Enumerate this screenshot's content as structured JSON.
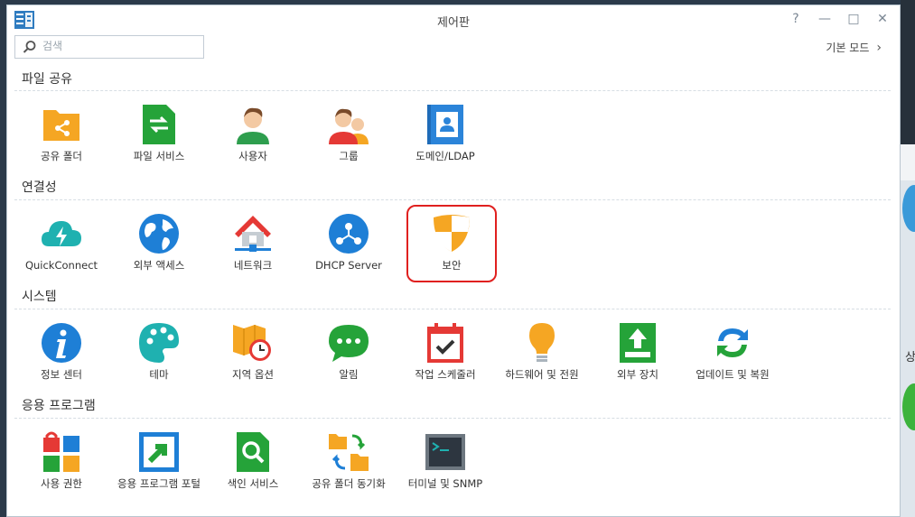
{
  "window": {
    "title": "제어판",
    "controls": {
      "help": "?",
      "minimize": "—",
      "maximize": "□",
      "close": "✕"
    }
  },
  "search": {
    "placeholder": "검색",
    "value": ""
  },
  "basic_mode": {
    "label": "기본 모드",
    "icon": "chevron-right-icon"
  },
  "sections": [
    {
      "title": "파일 공유",
      "items": [
        {
          "label": "공유 폴더",
          "icon": "shared-folder-icon"
        },
        {
          "label": "파일 서비스",
          "icon": "file-services-icon"
        },
        {
          "label": "사용자",
          "icon": "user-icon"
        },
        {
          "label": "그룹",
          "icon": "group-icon"
        },
        {
          "label": "도메인/LDAP",
          "icon": "domain-ldap-icon"
        }
      ]
    },
    {
      "title": "연결성",
      "items": [
        {
          "label": "QuickConnect",
          "icon": "quickconnect-icon"
        },
        {
          "label": "외부 액세스",
          "icon": "external-access-icon"
        },
        {
          "label": "네트워크",
          "icon": "network-icon"
        },
        {
          "label": "DHCP Server",
          "icon": "dhcp-server-icon"
        },
        {
          "label": "보안",
          "icon": "security-shield-icon",
          "highlighted": true
        }
      ]
    },
    {
      "title": "시스템",
      "items": [
        {
          "label": "정보 센터",
          "icon": "info-center-icon"
        },
        {
          "label": "테마",
          "icon": "theme-palette-icon"
        },
        {
          "label": "지역 옵션",
          "icon": "regional-options-icon"
        },
        {
          "label": "알림",
          "icon": "notification-icon"
        },
        {
          "label": "작업 스케줄러",
          "icon": "task-scheduler-icon"
        },
        {
          "label": "하드웨어 및 전원",
          "icon": "hardware-power-icon"
        },
        {
          "label": "외부 장치",
          "icon": "external-devices-icon"
        },
        {
          "label": "업데이트 및 복원",
          "icon": "update-restore-icon"
        }
      ]
    },
    {
      "title": "응용 프로그램",
      "items": [
        {
          "label": "사용 권한",
          "icon": "privileges-icon"
        },
        {
          "label": "응용 프로그램 포털",
          "icon": "application-portal-icon"
        },
        {
          "label": "색인 서비스",
          "icon": "indexing-service-icon"
        },
        {
          "label": "공유 폴더 동기화",
          "icon": "shared-folder-sync-icon"
        },
        {
          "label": "터미널 및 SNMP",
          "icon": "terminal-snmp-icon"
        }
      ]
    }
  ],
  "background_glyph": "상",
  "colors": {
    "highlight_border": "#e0201f",
    "accent_blue": "#1e7fd6",
    "accent_green": "#25a339",
    "accent_orange": "#f5a623"
  }
}
